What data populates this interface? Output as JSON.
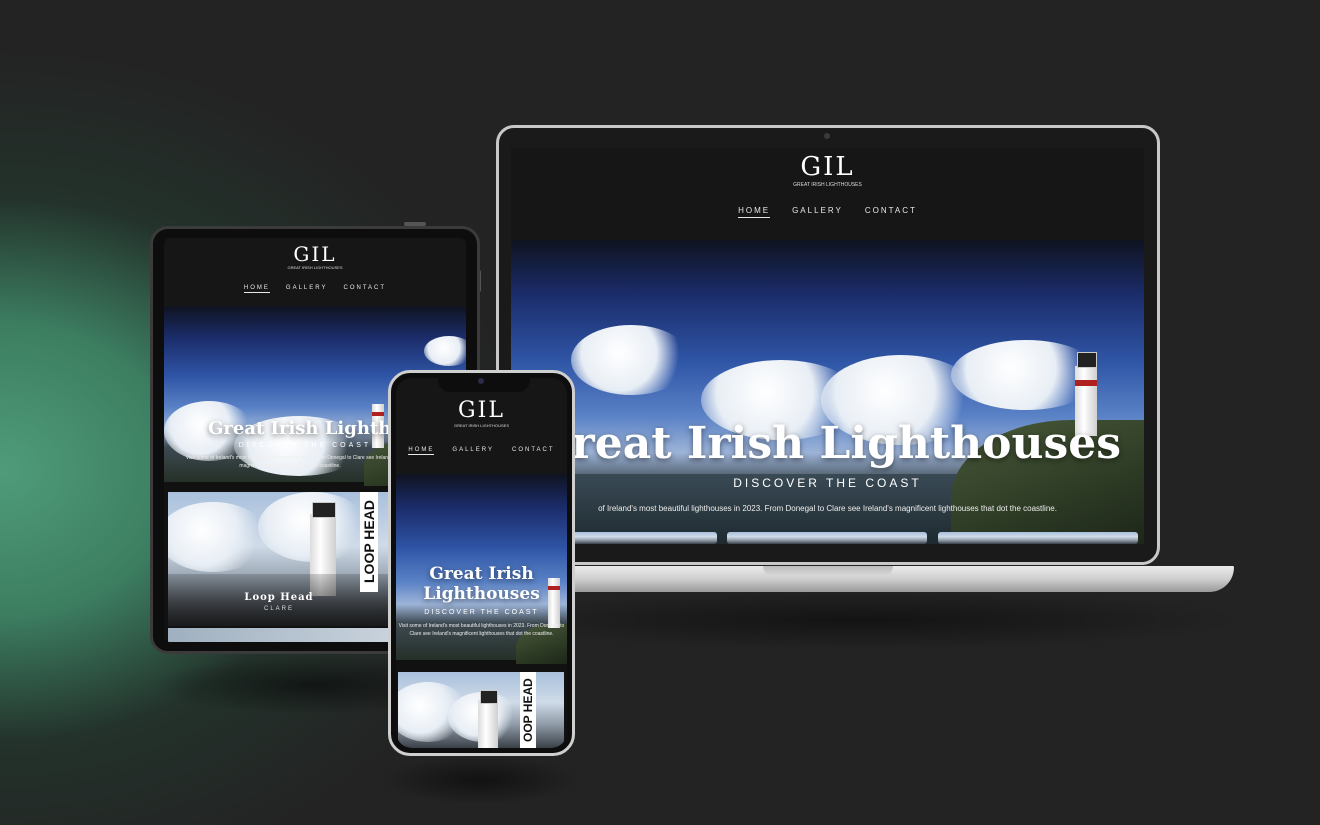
{
  "site": {
    "logo_mark": "GIL",
    "logo_sub": "GREAT IRISH LIGHTHOUSES",
    "nav": [
      {
        "label": "HOME",
        "active": true
      },
      {
        "label": "GALLERY",
        "active": false
      },
      {
        "label": "CONTACT",
        "active": false
      }
    ],
    "hero_title": "Great Irish Lighthouses",
    "hero_title_line1": "Great Irish",
    "hero_title_line2": "Lighthouses",
    "hero_subtitle": "DISCOVER THE COAST",
    "hero_text": "Visit some of Ireland's most beautiful lighthouses in 2023. From Donegal to Clare see Ireland's magnificent lighthouses that dot the coastline.",
    "laptop_hero_text": "of Ireland's most beautiful lighthouses in 2023. From Donegal to Clare see Ireland's magnificent lighthouses that dot the coastline.",
    "featured_card": {
      "title": "Loop Head",
      "location": "CLARE",
      "vertical_label": "LOOP HEAD"
    },
    "phone_vertical_label": "OOP HEAD"
  },
  "colors": {
    "background": "#232323",
    "accent_green": "#4f9c7a",
    "sky_blue": "#2f55a6",
    "lighthouse_red": "#b02020"
  }
}
